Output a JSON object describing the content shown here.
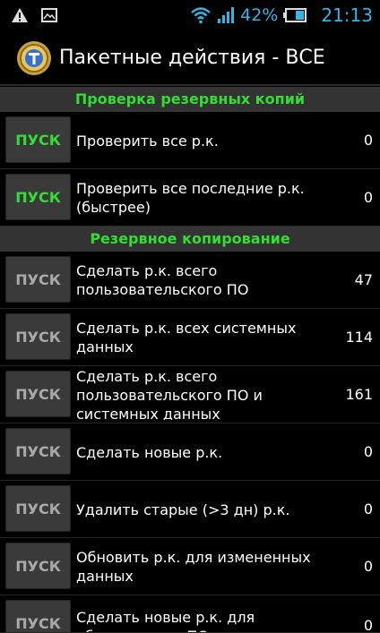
{
  "status_bar": {
    "battery_percent": "42%",
    "time": "21:13",
    "icons": [
      "warning-icon",
      "image-icon",
      "wifi-icon",
      "signal-icon",
      "battery-icon"
    ],
    "accent_color": "#33b5e5"
  },
  "header": {
    "title": "Пакетные действия - ВСЕ",
    "icon": "titanium-backup-icon"
  },
  "sections": [
    {
      "title": "Проверка резервных копий",
      "rows": [
        {
          "button": "ПУСК",
          "label": "Проверить все р.к.",
          "count": "0",
          "button_color": "green"
        },
        {
          "button": "ПУСК",
          "label": "Проверить все последние р.к. (быстрее)",
          "count": "0",
          "button_color": "green"
        }
      ]
    },
    {
      "title": "Резервное копирование",
      "rows": [
        {
          "button": "ПУСК",
          "label": "Сделать р.к. всего пользовательского ПО",
          "count": "47",
          "button_color": "gray"
        },
        {
          "button": "ПУСК",
          "label": "Сделать р.к. всех системных данных",
          "count": "114",
          "button_color": "gray"
        },
        {
          "button": "ПУСК",
          "label": "Сделать р.к. всего пользовательского ПО и системных данных",
          "count": "161",
          "button_color": "gray"
        },
        {
          "button": "ПУСК",
          "label": "Сделать новые р.к.",
          "count": "0",
          "button_color": "gray"
        },
        {
          "button": "ПУСК",
          "label": "Удалить старые (>3 дн) р.к.",
          "count": "0",
          "button_color": "gray"
        },
        {
          "button": "ПУСК",
          "label": "Обновить р.к. для измененных данных",
          "count": "0",
          "button_color": "gray"
        },
        {
          "button": "ПУСК",
          "label": "Сделать новые р.к. для обновленного ПО",
          "count": "0",
          "button_color": "gray"
        }
      ]
    }
  ],
  "colors": {
    "section_header_text": "#33dd33",
    "section_header_bg": "#333333",
    "button_bg": "#3a3a3a"
  }
}
